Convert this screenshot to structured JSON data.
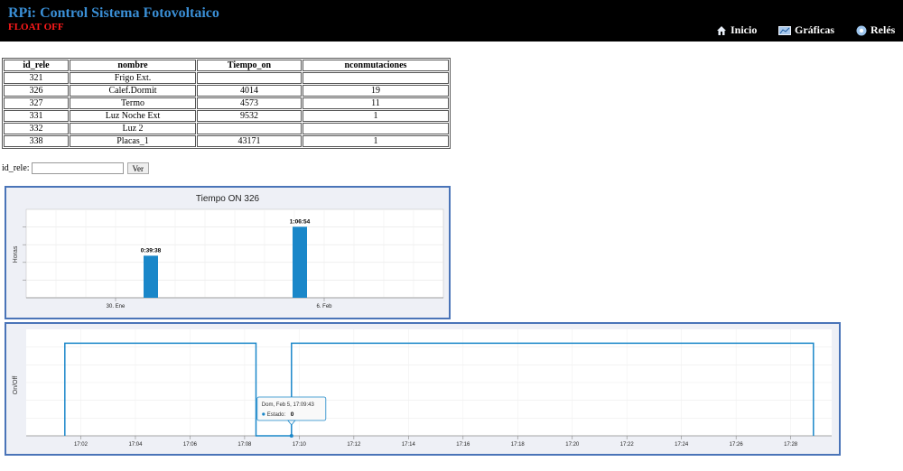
{
  "header": {
    "title": "RPi: Control Sistema Fotovoltaico",
    "float_status": "FLOAT OFF",
    "nav": [
      {
        "label": "Inicio",
        "icon": "home-icon"
      },
      {
        "label": "Gráficas",
        "icon": "chart-icon"
      },
      {
        "label": "Relés",
        "icon": "gear-icon"
      }
    ]
  },
  "relays_table": {
    "columns": [
      "id_rele",
      "nombre",
      "Tiempo_on",
      "nconmutaciones"
    ],
    "rows": [
      [
        "321",
        "Frigo Ext.",
        "",
        ""
      ],
      [
        "326",
        "Calef.Dormit",
        "4014",
        "19"
      ],
      [
        "327",
        "Termo",
        "4573",
        "11"
      ],
      [
        "331",
        "Luz Noche Ext",
        "9532",
        "1"
      ],
      [
        "332",
        "Luz 2",
        "",
        ""
      ],
      [
        "338",
        "Placas_1",
        "43171",
        "1"
      ]
    ]
  },
  "filter": {
    "label": "id_rele:",
    "value": "",
    "button_label": "Ver"
  },
  "colors": {
    "bar": "#1a87c9",
    "line": "#1a87c9",
    "header_bg": "#000000",
    "title": "#3a8fd6",
    "status": "#ff1a1a"
  },
  "chart_data": [
    {
      "type": "bar",
      "title": "Tiempo ON 326",
      "ylabel": "Horas",
      "xticks": [
        "30. Ene",
        "6. Feb"
      ],
      "bars": [
        {
          "date": "2014-01-31",
          "seconds": 2378,
          "label": "0:39:38"
        },
        {
          "date": "2014-02-05",
          "seconds": 4014,
          "label": "1:06:54"
        }
      ],
      "ylim_seconds": [
        0,
        5000
      ]
    },
    {
      "type": "line",
      "title": "",
      "ylabel": "On/Off",
      "xticks": [
        "17:02",
        "17:04",
        "17:06",
        "17:08",
        "17:10",
        "17:12",
        "17:14",
        "17:16",
        "17:18",
        "17:20",
        "17:22",
        "17:24",
        "17:26",
        "17:28"
      ],
      "points": [
        [
          "17:01:25",
          0
        ],
        [
          "17:01:25",
          1
        ],
        [
          "17:08:25",
          1
        ],
        [
          "17:08:25",
          0
        ],
        [
          "17:09:43",
          0
        ],
        [
          "17:09:43",
          1
        ],
        [
          "17:28:50",
          1
        ],
        [
          "17:28:50",
          0
        ]
      ],
      "ylim": [
        0,
        1.15
      ],
      "tooltip": {
        "title": "Dom, Feb 5, 17:09:43",
        "series": "Estado:",
        "value": "0"
      }
    }
  ]
}
